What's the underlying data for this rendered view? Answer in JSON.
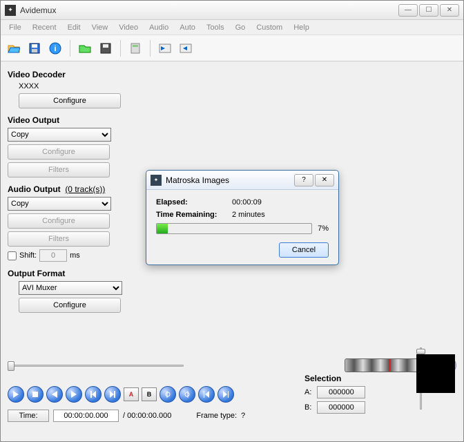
{
  "app": {
    "title": "Avidemux"
  },
  "menu": [
    "File",
    "Recent",
    "Edit",
    "View",
    "Video",
    "Audio",
    "Auto",
    "Tools",
    "Go",
    "Custom",
    "Help"
  ],
  "panels": {
    "video_decoder": {
      "header": "Video Decoder",
      "name": "XXXX",
      "configure": "Configure"
    },
    "video_output": {
      "header": "Video Output",
      "selected": "Copy",
      "configure": "Configure",
      "filters": "Filters"
    },
    "audio_output": {
      "header": "Audio Output",
      "tracks": "(0 track(s))",
      "selected": "Copy",
      "configure": "Configure",
      "filters": "Filters",
      "shift_label": "Shift:",
      "shift_value": "0",
      "shift_unit": "ms"
    },
    "output_format": {
      "header": "Output Format",
      "selected": "AVI Muxer",
      "configure": "Configure"
    }
  },
  "selection": {
    "header": "Selection",
    "a_label": "A:",
    "a_value": "000000",
    "b_label": "B:",
    "b_value": "000000"
  },
  "time": {
    "button": "Time:",
    "current": "00:00:00.000",
    "total": "/ 00:00:00.000",
    "frame_label": "Frame type:",
    "frame_value": "?"
  },
  "dialog": {
    "title": "Matroska Images",
    "elapsed_label": "Elapsed:",
    "elapsed_value": "00:00:09",
    "remaining_label": "Time Remaining:",
    "remaining_value": "2 minutes",
    "percent": "7%",
    "cancel": "Cancel"
  }
}
